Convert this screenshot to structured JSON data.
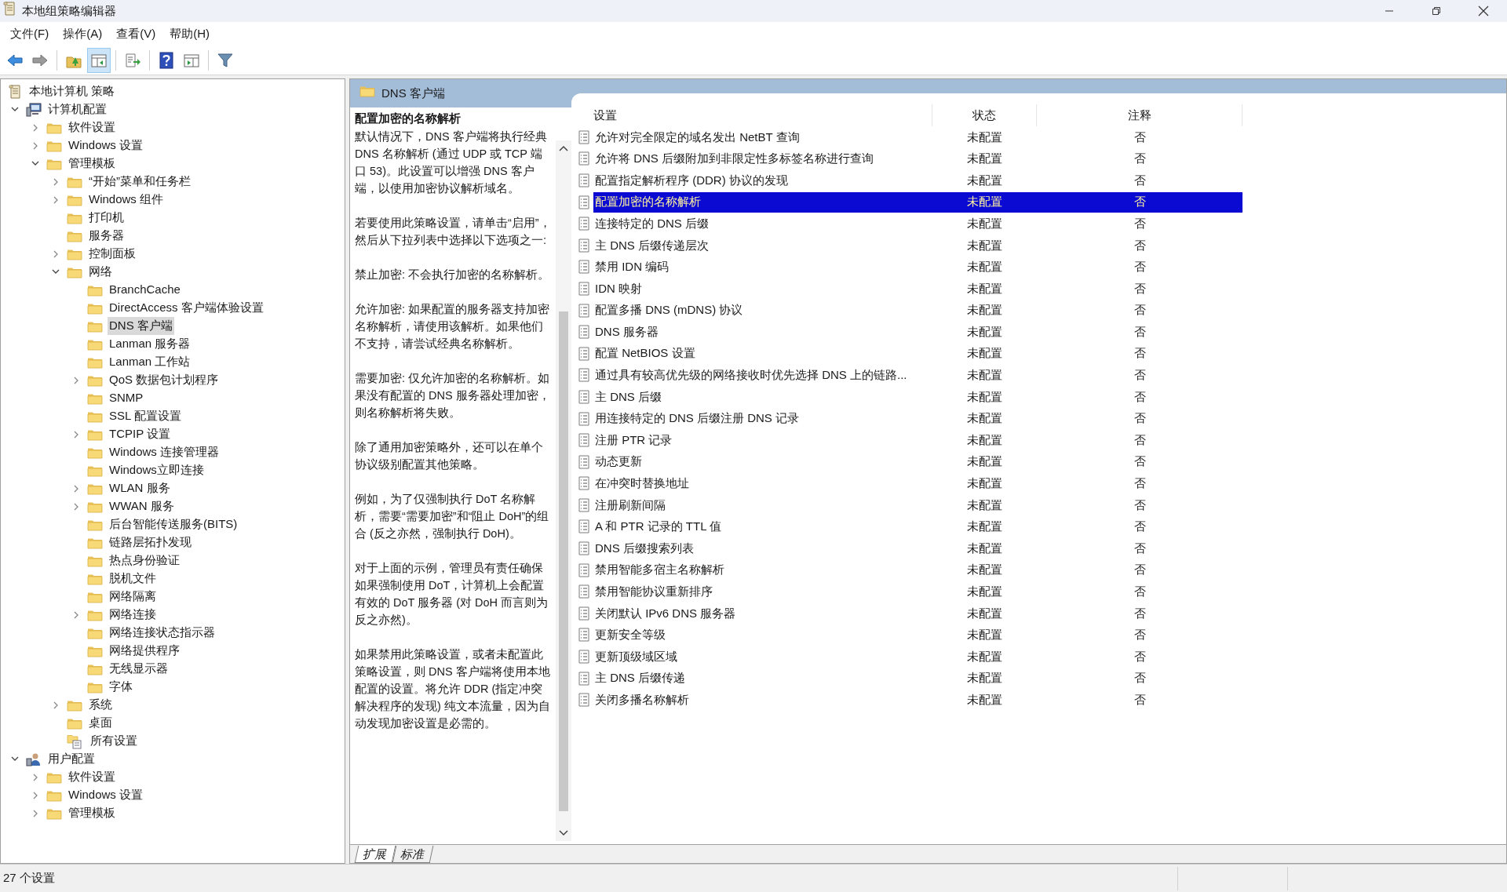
{
  "window": {
    "title": "本地组策略编辑器"
  },
  "menu": [
    "文件(F)",
    "操作(A)",
    "查看(V)",
    "帮助(H)"
  ],
  "toolbar": [
    {
      "kind": "back"
    },
    {
      "kind": "forward"
    },
    {
      "kind": "sep"
    },
    {
      "kind": "up"
    },
    {
      "kind": "tree",
      "pressed": true
    },
    {
      "kind": "sep"
    },
    {
      "kind": "export"
    },
    {
      "kind": "sep"
    },
    {
      "kind": "help"
    },
    {
      "kind": "action"
    },
    {
      "kind": "sep"
    },
    {
      "kind": "filter"
    }
  ],
  "tree": [
    {
      "label": "本地计算机 策略",
      "kind": "policy",
      "selected": false,
      "children": [
        {
          "label": "计算机配置",
          "kind": "computer",
          "expanded": true,
          "selected": false,
          "children": [
            {
              "label": "软件设置",
              "kind": "folder",
              "expanded": false,
              "selected": false
            },
            {
              "label": "Windows 设置",
              "kind": "folder",
              "expanded": false,
              "selected": false
            },
            {
              "label": "管理模板",
              "kind": "folder",
              "expanded": true,
              "selected": false,
              "children": [
                {
                  "label": "“开始”菜单和任务栏",
                  "kind": "folder",
                  "expanded": false,
                  "selected": false
                },
                {
                  "label": "Windows 组件",
                  "kind": "folder",
                  "expanded": false,
                  "selected": false
                },
                {
                  "label": "打印机",
                  "kind": "folder",
                  "selected": false
                },
                {
                  "label": "服务器",
                  "kind": "folder",
                  "selected": false
                },
                {
                  "label": "控制面板",
                  "kind": "folder",
                  "expanded": false,
                  "selected": false
                },
                {
                  "label": "网络",
                  "kind": "folder",
                  "expanded": true,
                  "selected": false,
                  "children": [
                    {
                      "label": "BranchCache",
                      "kind": "folder",
                      "selected": false
                    },
                    {
                      "label": "DirectAccess 客户端体验设置",
                      "kind": "folder",
                      "selected": false
                    },
                    {
                      "label": "DNS 客户端",
                      "kind": "folder",
                      "selected": true
                    },
                    {
                      "label": "Lanman 服务器",
                      "kind": "folder",
                      "selected": false
                    },
                    {
                      "label": "Lanman 工作站",
                      "kind": "folder",
                      "selected": false
                    },
                    {
                      "label": "QoS 数据包计划程序",
                      "kind": "folder",
                      "expanded": false,
                      "selected": false
                    },
                    {
                      "label": "SNMP",
                      "kind": "folder",
                      "selected": false
                    },
                    {
                      "label": "SSL 配置设置",
                      "kind": "folder",
                      "selected": false
                    },
                    {
                      "label": "TCPIP 设置",
                      "kind": "folder",
                      "expanded": false,
                      "selected": false
                    },
                    {
                      "label": "Windows 连接管理器",
                      "kind": "folder",
                      "selected": false
                    },
                    {
                      "label": "Windows立即连接",
                      "kind": "folder",
                      "selected": false
                    },
                    {
                      "label": "WLAN 服务",
                      "kind": "folder",
                      "expanded": false,
                      "selected": false
                    },
                    {
                      "label": "WWAN 服务",
                      "kind": "folder",
                      "expanded": false,
                      "selected": false
                    },
                    {
                      "label": "后台智能传送服务(BITS)",
                      "kind": "folder",
                      "selected": false
                    },
                    {
                      "label": "链路层拓扑发现",
                      "kind": "folder",
                      "selected": false
                    },
                    {
                      "label": "热点身份验证",
                      "kind": "folder",
                      "selected": false
                    },
                    {
                      "label": "脱机文件",
                      "kind": "folder",
                      "selected": false
                    },
                    {
                      "label": "网络隔离",
                      "kind": "folder",
                      "selected": false
                    },
                    {
                      "label": "网络连接",
                      "kind": "folder",
                      "expanded": false,
                      "selected": false
                    },
                    {
                      "label": "网络连接状态指示器",
                      "kind": "folder",
                      "selected": false
                    },
                    {
                      "label": "网络提供程序",
                      "kind": "folder",
                      "selected": false
                    },
                    {
                      "label": "无线显示器",
                      "kind": "folder",
                      "selected": false
                    },
                    {
                      "label": "字体",
                      "kind": "folder",
                      "selected": false
                    }
                  ]
                },
                {
                  "label": "系统",
                  "kind": "folder",
                  "expanded": false,
                  "selected": false
                },
                {
                  "label": "桌面",
                  "kind": "folder",
                  "selected": false
                },
                {
                  "label": "所有设置",
                  "kind": "allsettings",
                  "selected": false
                }
              ]
            }
          ]
        },
        {
          "label": "用户配置",
          "kind": "user",
          "expanded": true,
          "selected": false,
          "children": [
            {
              "label": "软件设置",
              "kind": "folder",
              "expanded": false,
              "selected": false
            },
            {
              "label": "Windows 设置",
              "kind": "folder",
              "expanded": false,
              "selected": false
            },
            {
              "label": "管理模板",
              "kind": "folder",
              "expanded": false,
              "selected": false
            }
          ]
        }
      ]
    }
  ],
  "pane_title": "DNS 客户端",
  "description": {
    "title": "配置加密的名称解析",
    "paragraphs": [
      "默认情况下，DNS 客户端将执行经典 DNS 名称解析 (通过 UDP 或 TCP 端口 53)。此设置可以增强 DNS 客户端，以使用加密协议解析域名。",
      "若要使用此策略设置，请单击“启用”，然后从下拉列表中选择以下选项之一:",
      "禁止加密: 不会执行加密的名称解析。",
      "允许加密: 如果配置的服务器支持加密名称解析，请使用该解析。如果他们不支持，请尝试经典名称解析。",
      "需要加密: 仅允许加密的名称解析。如果没有配置的 DNS 服务器处理加密，则名称解析将失败。",
      "除了通用加密策略外，还可以在单个协议级别配置其他策略。",
      "例如，为了仅强制执行 DoT 名称解析，需要“需要加密”和“阻止 DoH”的组合 (反之亦然，强制执行 DoH)。",
      "对于上面的示例，管理员有责任确保如果强制使用 DoT，计算机上会配置有效的 DoT 服务器 (对 DoH 而言则为反之亦然)。",
      "如果禁用此策略设置，或者未配置此策略设置，则 DNS 客户端将使用本地配置的设置。将允许 DDR (指定冲突解决程序的发现) 纯文本流量，因为自动发现加密设置是必需的。"
    ]
  },
  "table": {
    "columns": [
      "设置",
      "状态",
      "注释"
    ],
    "rows": [
      {
        "setting": "允许对完全限定的域名发出 NetBT 查询",
        "state": "未配置",
        "comment": "否",
        "selected": false
      },
      {
        "setting": "允许将 DNS 后缀附加到非限定性多标签名称进行查询",
        "state": "未配置",
        "comment": "否",
        "selected": false
      },
      {
        "setting": "配置指定解析程序 (DDR) 协议的发现",
        "state": "未配置",
        "comment": "否",
        "selected": false
      },
      {
        "setting": "配置加密的名称解析",
        "state": "未配置",
        "comment": "否",
        "selected": true
      },
      {
        "setting": "连接特定的 DNS 后缀",
        "state": "未配置",
        "comment": "否",
        "selected": false
      },
      {
        "setting": "主 DNS 后缀传递层次",
        "state": "未配置",
        "comment": "否",
        "selected": false
      },
      {
        "setting": "禁用 IDN 编码",
        "state": "未配置",
        "comment": "否",
        "selected": false
      },
      {
        "setting": "IDN 映射",
        "state": "未配置",
        "comment": "否",
        "selected": false
      },
      {
        "setting": "配置多播 DNS (mDNS) 协议",
        "state": "未配置",
        "comment": "否",
        "selected": false
      },
      {
        "setting": "DNS 服务器",
        "state": "未配置",
        "comment": "否",
        "selected": false
      },
      {
        "setting": "配置 NetBIOS 设置",
        "state": "未配置",
        "comment": "否",
        "selected": false
      },
      {
        "setting": "通过具有较高优先级的网络接收时优先选择 DNS 上的链路...",
        "state": "未配置",
        "comment": "否",
        "selected": false
      },
      {
        "setting": "主 DNS 后缀",
        "state": "未配置",
        "comment": "否",
        "selected": false
      },
      {
        "setting": "用连接特定的 DNS 后缀注册 DNS 记录",
        "state": "未配置",
        "comment": "否",
        "selected": false
      },
      {
        "setting": "注册 PTR 记录",
        "state": "未配置",
        "comment": "否",
        "selected": false
      },
      {
        "setting": "动态更新",
        "state": "未配置",
        "comment": "否",
        "selected": false
      },
      {
        "setting": "在冲突时替换地址",
        "state": "未配置",
        "comment": "否",
        "selected": false
      },
      {
        "setting": "注册刷新间隔",
        "state": "未配置",
        "comment": "否",
        "selected": false
      },
      {
        "setting": "A 和 PTR 记录的 TTL 值",
        "state": "未配置",
        "comment": "否",
        "selected": false
      },
      {
        "setting": "DNS 后缀搜索列表",
        "state": "未配置",
        "comment": "否",
        "selected": false
      },
      {
        "setting": "禁用智能多宿主名称解析",
        "state": "未配置",
        "comment": "否",
        "selected": false
      },
      {
        "setting": "禁用智能协议重新排序",
        "state": "未配置",
        "comment": "否",
        "selected": false
      },
      {
        "setting": "关闭默认 IPv6 DNS 服务器",
        "state": "未配置",
        "comment": "否",
        "selected": false
      },
      {
        "setting": "更新安全等级",
        "state": "未配置",
        "comment": "否",
        "selected": false
      },
      {
        "setting": "更新顶级域区域",
        "state": "未配置",
        "comment": "否",
        "selected": false
      },
      {
        "setting": "主 DNS 后缀传递",
        "state": "未配置",
        "comment": "否",
        "selected": false
      },
      {
        "setting": "关闭多播名称解析",
        "state": "未配置",
        "comment": "否",
        "selected": false
      }
    ]
  },
  "tabs": [
    {
      "label": "扩展",
      "selected": true
    },
    {
      "label": "标准",
      "selected": false
    }
  ],
  "status_bar": "27 个设置"
}
